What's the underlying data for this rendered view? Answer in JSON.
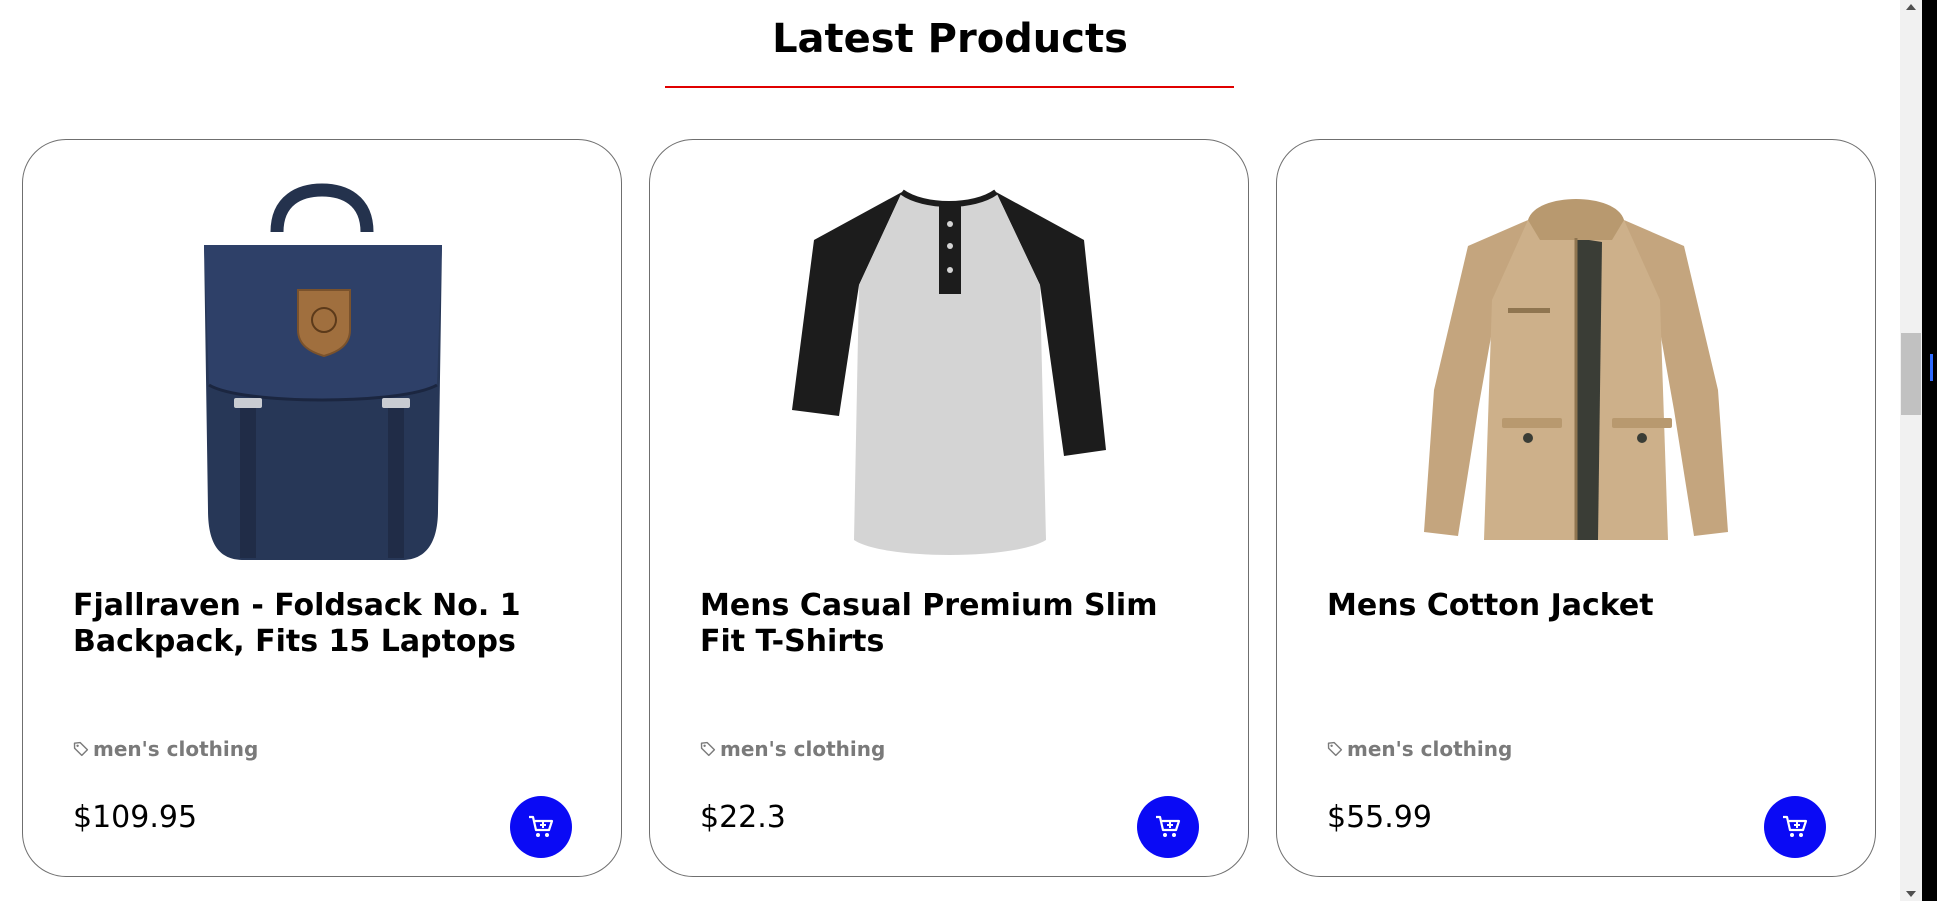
{
  "section": {
    "title": "Latest Products"
  },
  "products": [
    {
      "name": "Fjallraven - Foldsack No. 1 Backpack, Fits 15 Laptops",
      "category": "men's clothing",
      "price": "$109.95",
      "image_icon": "backpack-image"
    },
    {
      "name": "Mens Casual Premium Slim Fit T-Shirts",
      "category": "men's clothing",
      "price": "$22.3",
      "image_icon": "raglan-tshirt-image"
    },
    {
      "name": "Mens Cotton Jacket",
      "category": "men's clothing",
      "price": "$55.99",
      "image_icon": "cotton-jacket-image"
    }
  ],
  "icons": {
    "category": "tag-icon",
    "cart": "add-to-cart-icon"
  },
  "colors": {
    "title_underline": "#e00000",
    "cart_button": "#0a0af5",
    "category_text": "#7a7a7a"
  }
}
